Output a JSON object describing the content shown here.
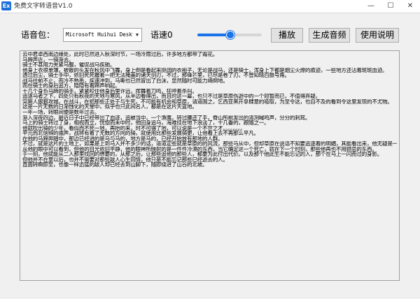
{
  "window": {
    "title": "免费文字转语音V1.0",
    "icon_text": "Ex",
    "minimize": "—",
    "maximize": "☐",
    "close": "✕"
  },
  "toolbar": {
    "voice_label": "语音包：",
    "voice_value": "Microsoft Huihui Desktop - C",
    "speed_label": "语速0",
    "speed_level": 0.5,
    "play_label": "播放",
    "generate_label": "生成音频",
    "help_label": "使用说明"
  },
  "colors": {
    "accent": "#1a73e8"
  },
  "text_lines": [
    "云中君卓西南边缘处，此时已然进入秋深时节，一场冷雨过后，许多地方都带了霜花。",
    "  马蹄声近，一骑渐去。",
    "  骑士不甚用力夹紧马腹，催促战马疾驰。",
    "  他身上衣很单薄，披散的头发在秋风中飞舞，身上倒是看起来挺阔的衣袍子，无论是战马，还是骑士，浑身上下都是烟尘火燎的痕迹，一些地方还沾着斑斑血迹。",
    "  透过后尘，骑士手中，依旧死死握着一把无法掩盖的诸天剑刃，不过，那锋芒里，已尽是卷了刃，不曾知晓白鼓号角。",
    "  战马往前不止，而冷不熟悉，疾速冲到，马嘶也已然冒出了白沫，显然随时可能力竭倒地。",
    "  而在骑士的身后追方，隐隐有着蹄声响起。",
    "  十几个身负马蹄的骑手，紧紧咬住他身后里许远，挥舞着刀鸣，狂呼着杀叫。",
    "  追逐马者之下，四处只有秋夜的天地与寒风，从半边看得出，而且时这一幕，也只不过是草原伤逝中的一个短暂而已，不值得弃疑。",
    "  突厥人狠狠攻城，在战斗，在扼那些正处于与生死，不可能有机会和草原，请道国之，乞西亚黑开拿肆意的吸取，为至令这，也自不及的看到令这里发现的不尤物。",
    "  这是一片无数的日渐蚀化的天堂中，似乎也只此间名人，都是在这片天蓝地。",
    "  一年一场，转眼间便是数年过去。",
    "  渐入深夜四边，最近日子中已经带出了血迹，追被当中，一个渔鹰，转过腰还了手，脊山所前发出的清冽喊鸣声，分分的刺耳。",
    "  马上的骑士转过了身，相视而立，恍惚而未中时，他回身追马，海难挂在地下浪淡了，十几番的，跟随之一。",
    "  他就吹出骑的少年，看似而不死一地，再抬的来，时不可得了地，可以说是一个不世之才。。。。。。。。",
    "  平元而北信辨的德声，战将有着了无数的方向的骑，就使用比那些发展骑更，让他看上去不再那么平凡。",
    "  在他的马蹄奔踏中，那边已经进的是马与马的，地方是马的，已经开始放有那地的人群。",
    "  不过，就是这片的土地上，如果是上到马入并不多少的话，道道定些就是草原的的风流，那些马从中，但却草原在说话不知要追逐着的明媚，其能看出来，他无疑是一个汉人。",
    "  从他的眼中可以看到，但他的目光依旧平静，他的眼神所映射的是一件件冷漠的东西，当它确定这一个死亡，就在下一个时刻，那些他再也不用顾忌的东西。",
    "  于一刻，他就能从二人那里找回的想要的，从那之后，让那些追他的那些人，都要为此付出代价。以及那个他此生不能忘记的人，那个在马上一闪而过的身影。",
    "  但他并不在意以后，也并不需要对那些敌人心生同情，他只是不能忘记那些已经逝去的人。",
    "  直面转瞬即至，也像一样迅猛的敌人却已经去到山脚下，随即绕进了山谷的北坡。"
  ]
}
